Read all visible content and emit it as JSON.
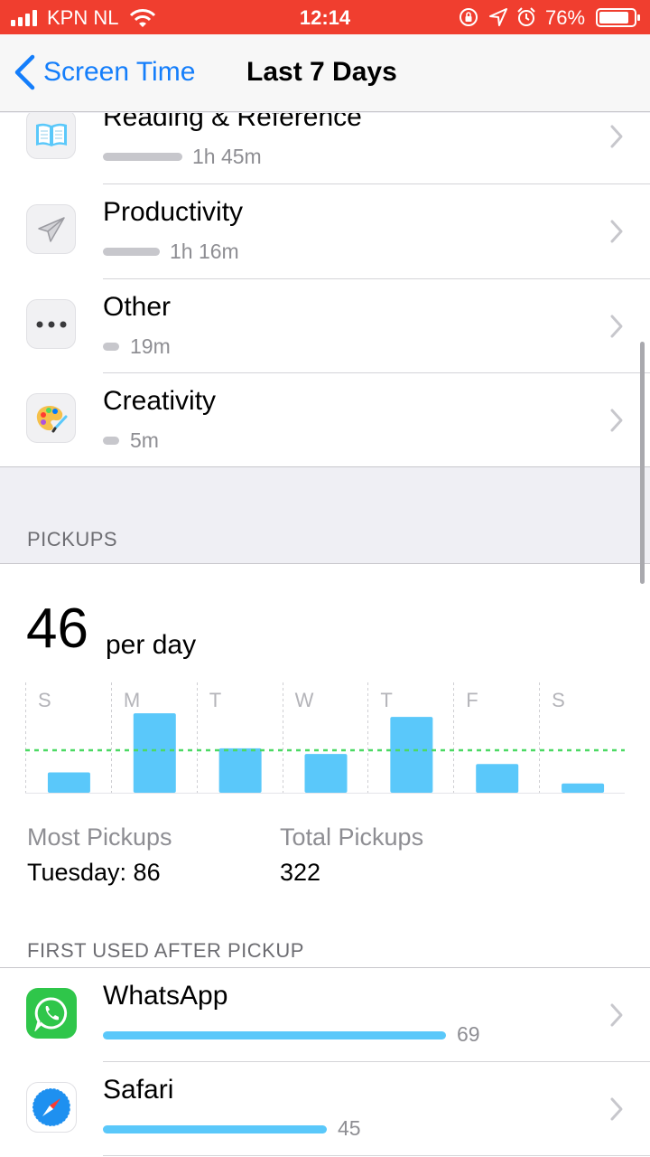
{
  "status_bar": {
    "carrier": "KPN NL",
    "time": "12:14",
    "battery": "76%",
    "bg_color": "#f03e2f"
  },
  "nav": {
    "back_label": "Screen Time",
    "title": "Last 7 Days",
    "accent_color": "#147efb"
  },
  "categories": [
    {
      "name": "Reading & Reference",
      "time": "1h 45m",
      "icon": "book-icon"
    },
    {
      "name": "Productivity",
      "time": "1h 16m",
      "icon": "paper-plane-icon"
    },
    {
      "name": "Other",
      "time": "19m",
      "icon": "ellipsis-icon"
    },
    {
      "name": "Creativity",
      "time": "5m",
      "icon": "palette-icon"
    }
  ],
  "pickups": {
    "header": "PICKUPS",
    "per_day_value": "46",
    "per_day_label": "per day",
    "most_label": "Most Pickups",
    "most_value": "Tuesday: 86",
    "total_label": "Total Pickups",
    "total_value": "322"
  },
  "chart_data": {
    "type": "bar",
    "categories": [
      "S",
      "M",
      "T",
      "W",
      "T",
      "F",
      "S"
    ],
    "values": [
      22,
      86,
      48,
      42,
      82,
      31,
      10
    ],
    "average": 46,
    "ylim": [
      0,
      90
    ],
    "bar_color": "#5ac8fa",
    "average_line_color": "#4cd964",
    "grid": true
  },
  "first_used": {
    "header": "FIRST USED AFTER PICKUP",
    "apps": [
      {
        "name": "WhatsApp",
        "count": "69",
        "value": 69,
        "icon": "whatsapp-icon"
      },
      {
        "name": "Safari",
        "count": "45",
        "value": 45,
        "icon": "safari-icon"
      }
    ]
  }
}
